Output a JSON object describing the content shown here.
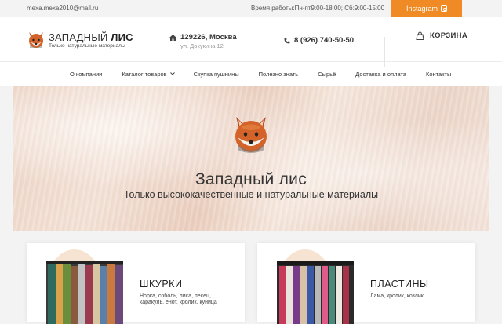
{
  "topbar": {
    "email": "mexa.mexa2010@mail.ru",
    "hours": "Время работы:Пн-пт9:00-18:00; Сб:9:00-15:00",
    "instagram_label": "Instagram",
    "instagram_icon": "instagram-icon"
  },
  "header": {
    "logo_title_light": "ЗАПАДНЫЙ ",
    "logo_title_bold": "ЛИС",
    "logo_subtitle": "Только натуральные материалы",
    "address_city": "129226, Москва",
    "address_street": "ул. Докукина 12",
    "phone": "8 (926) 740-50-50",
    "cart_label": "КОРЗИНА"
  },
  "nav": {
    "items": [
      {
        "label": "О компании"
      },
      {
        "label": "Каталог товаров"
      },
      {
        "label": "Скупка пушнины"
      },
      {
        "label": "Полезно знать"
      },
      {
        "label": "Сырьё"
      },
      {
        "label": "Доставка и оплата"
      },
      {
        "label": "Контакты"
      }
    ]
  },
  "hero": {
    "title": "Западный лис",
    "subtitle": "Только высококачественные и натуральные материалы"
  },
  "cards": [
    {
      "title": "ШКУРКИ",
      "description": "Норка, соболь, лиса, песец, каракуль, енот, кролик, куница"
    },
    {
      "title": "ПЛАСТИНЫ",
      "description": "Лама, кролик, козлик"
    }
  ],
  "colors": {
    "accent": "#f08a24",
    "fox_orange": "#d4632a"
  }
}
